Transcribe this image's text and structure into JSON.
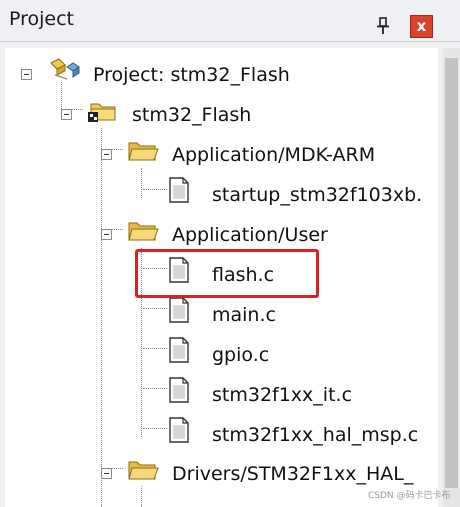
{
  "panel": {
    "title": "Project",
    "pin_glyph": "⎐",
    "close_glyph": "x"
  },
  "tree": {
    "nodes": [
      {
        "label": "Project: stm32_Flash",
        "icon": "project-icon",
        "expanded": true
      },
      {
        "label": "stm32_Flash",
        "icon": "target-folder-icon",
        "expanded": true
      },
      {
        "label": "Application/MDK-ARM",
        "icon": "folder-icon",
        "expanded": true
      },
      {
        "label": "startup_stm32f103xb.",
        "icon": "file-icon"
      },
      {
        "label": "Application/User",
        "icon": "folder-icon",
        "expanded": true
      },
      {
        "label": "flash.c",
        "icon": "file-icon",
        "highlighted": true
      },
      {
        "label": "main.c",
        "icon": "file-icon"
      },
      {
        "label": "gpio.c",
        "icon": "file-icon"
      },
      {
        "label": "stm32f1xx_it.c",
        "icon": "file-icon"
      },
      {
        "label": "stm32f1xx_hal_msp.c",
        "icon": "file-icon"
      },
      {
        "label": "Drivers/STM32F1xx_HAL_",
        "icon": "folder-icon",
        "expanded": true
      }
    ]
  },
  "watermark": "CSDN @码卡巴卡布",
  "colors": {
    "highlight": "#e02020",
    "close_button": "#d9442f",
    "folder": "#f2c94c"
  }
}
